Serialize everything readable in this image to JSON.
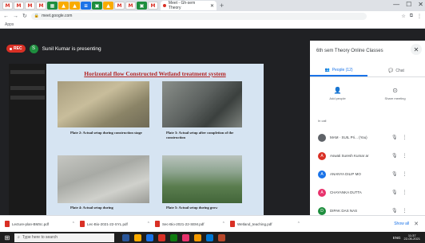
{
  "browser": {
    "pinned_tabs": [
      {
        "icon": "gmail-icon",
        "glyph": "M",
        "style": "gm"
      },
      {
        "icon": "gmail-icon",
        "glyph": "M",
        "style": "gm"
      },
      {
        "icon": "gmail-icon",
        "glyph": "M",
        "style": "gm"
      },
      {
        "icon": "gmail-icon",
        "glyph": "M",
        "style": "gm"
      },
      {
        "icon": "sheets-icon",
        "glyph": "▦",
        "style": "gr"
      },
      {
        "icon": "drive-icon",
        "glyph": "▲",
        "style": "ye"
      },
      {
        "icon": "drive-icon",
        "glyph": "▲",
        "style": "ye"
      },
      {
        "icon": "docs-icon",
        "glyph": "≡",
        "style": "bl"
      },
      {
        "icon": "classroom-icon",
        "glyph": "▣",
        "style": "gr"
      },
      {
        "icon": "drive-icon",
        "glyph": "▲",
        "style": "ye"
      },
      {
        "icon": "gmail-icon",
        "glyph": "M",
        "style": "gm"
      },
      {
        "icon": "gmail-icon",
        "glyph": "M",
        "style": "gm"
      },
      {
        "icon": "classroom-icon",
        "glyph": "▣",
        "style": "gr"
      },
      {
        "icon": "gmail-icon",
        "glyph": "M",
        "style": "gm"
      }
    ],
    "active_tab_title": "Meet - Gh-sem Theory",
    "inactive_tab_title": "",
    "new_tab": "+",
    "window_controls": [
      "—",
      "☐",
      "✕"
    ],
    "nav": {
      "back": "←",
      "forward": "→",
      "reload": "↻"
    },
    "url": "meet.google.com",
    "bookmarks_label": "Apps",
    "extension_icons": [
      "☆",
      "⧉",
      "⋮"
    ]
  },
  "meet": {
    "rec_label": "REC",
    "presenter_initial": "S",
    "presenting_text": "Sunil Kumar is presenting"
  },
  "slide": {
    "title": "Horizontal flow Constructed Wetland treatment system",
    "captions": [
      "Plate 2: Actual setup during construction stage",
      "Plate 3: Actual setup after completion of the construction",
      "Plate 4: Actual setup during",
      "Plate 5: Actual setup during grow"
    ]
  },
  "panel": {
    "title": "6th sem Theory Online Classes",
    "close": "✕",
    "tabs": [
      {
        "label": "People (12)",
        "icon": "people-icon",
        "glyph": "👥"
      },
      {
        "label": "Chat",
        "icon": "chat-icon",
        "glyph": "💬"
      }
    ],
    "actions": [
      {
        "label": "Add people",
        "icon": "add-person-icon",
        "glyph": "👤"
      },
      {
        "label": "Share meeting",
        "icon": "share-icon",
        "glyph": "⊙"
      }
    ],
    "section_label": "In call",
    "participants": [
      {
        "initial": "",
        "name": "MAM · SUIL Pri... (You)",
        "color": "#5f6368"
      },
      {
        "initial": "A",
        "name": "Aswati Suresh Kumar ar",
        "color": "#d93025"
      },
      {
        "initial": "A",
        "name": "ANANYA DILIP MO",
        "color": "#1a73e8"
      },
      {
        "initial": "A",
        "name": "CHAYANKA DUTTA",
        "color": "#e8336d"
      },
      {
        "initial": "D",
        "name": "DIPAK DAS NAS",
        "color": "#1e8e3e"
      }
    ]
  },
  "downloads": {
    "items": [
      "Lecture-plan-BMSc.pdf",
      "Lec-Bio-2021-22-SYL.pdf",
      "Sec-Bio-2021-22-SEM.pdf",
      "Wetland_teaching.pdf"
    ],
    "show_all": "Show all",
    "close": "✕"
  },
  "taskbar": {
    "start": "⊞",
    "search_placeholder": "Type here to search",
    "apps": [
      "#2b579a",
      "#f9ab00",
      "#1a73e8",
      "#d93025",
      "#107c10",
      "#e8336d",
      "#f29900",
      "#0078d4",
      "#b7472a"
    ],
    "time": "11:37",
    "date": "22-05-2021",
    "tray": "ENG"
  }
}
